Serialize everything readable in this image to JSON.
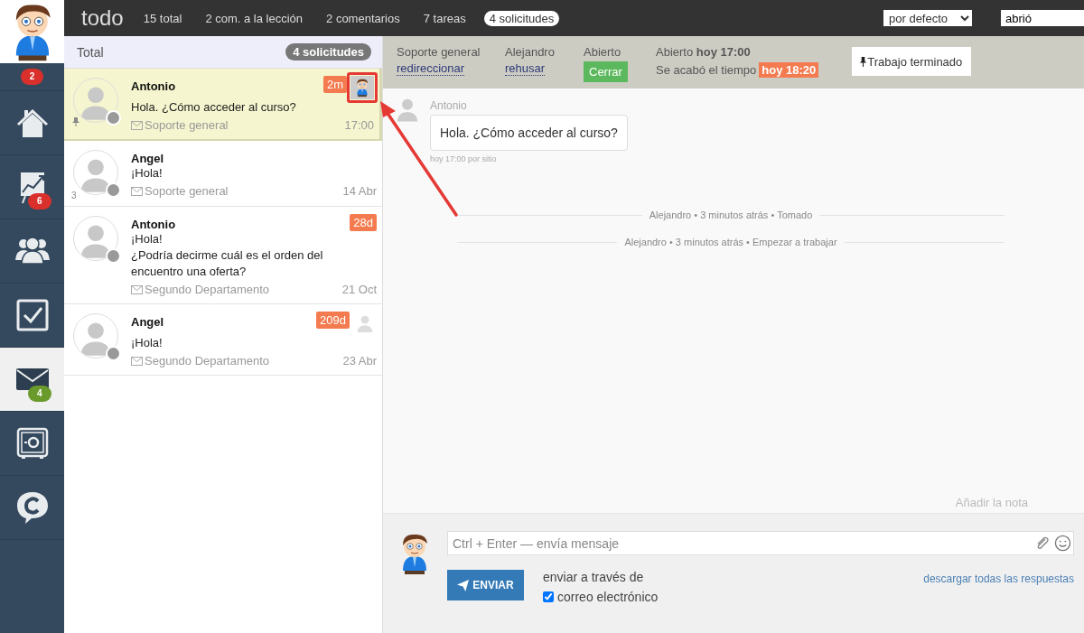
{
  "sidebar": {
    "alert_badge": {
      "text": "2",
      "color": "#d9302c"
    },
    "items": [
      {
        "kind": "home",
        "selected": false
      },
      {
        "kind": "chart",
        "selected": false,
        "badge": "6",
        "color": "#d9302c"
      },
      {
        "kind": "people",
        "selected": false
      },
      {
        "kind": "checkbox",
        "selected": false
      },
      {
        "kind": "mail",
        "selected": true,
        "badge": "4",
        "color": "#6b9a2c"
      },
      {
        "kind": "safe",
        "selected": false
      },
      {
        "kind": "chat",
        "selected": false
      }
    ]
  },
  "topbar": {
    "title": "todo",
    "tabs": [
      {
        "label": "15 total",
        "selected": false
      },
      {
        "label": "2 com. a la lección",
        "selected": false
      },
      {
        "label": "2 comentarios",
        "selected": false
      },
      {
        "label": "7 tareas",
        "selected": false
      },
      {
        "label": "4 solicitudes",
        "selected": true
      }
    ],
    "sort": "por defecto",
    "filter": "abrió"
  },
  "list": {
    "title": "Total",
    "count": "4 solicitudes",
    "tickets": [
      {
        "name": "Antonio",
        "lines": [
          "Hola. ¿Cómo acceder al curso?"
        ],
        "department": "Soporte general",
        "time": "17:00",
        "age": "2m",
        "assignee": {
          "kind": "avatar",
          "highlighted": true
        },
        "pinned": true,
        "selected": true
      },
      {
        "name": "Angel",
        "lines": [
          "¡Hola!"
        ],
        "department": "Soporte general",
        "time": "14 Abr",
        "count": "3",
        "pinned": false,
        "selected": false
      },
      {
        "name": "Antonio",
        "lines": [
          "¡Hola!",
          "¿Podría decirme cuál es el orden del encuentro una oferta?"
        ],
        "department": "Segundo Departamento",
        "time": "21 Oct",
        "age": "28d",
        "pinned": false,
        "selected": false
      },
      {
        "name": "Angel",
        "lines": [
          "¡Hola!"
        ],
        "department": "Segundo Departamento",
        "time": "23 Abr",
        "age": "209d",
        "assignee": {
          "kind": "placeholder",
          "highlighted": false
        },
        "pinned": false,
        "selected": false
      }
    ]
  },
  "header": {
    "department": {
      "label": "Soporte general",
      "action": "redireccionar"
    },
    "assignee": {
      "label": "Alejandro",
      "action": "rehusar"
    },
    "status": {
      "label": "Abierto",
      "action": "Cerrar"
    },
    "opened": "Abierto **hoy 17:00**",
    "deadline": {
      "label": "Se acabó el tiempo",
      "value": "hoy 18:20"
    },
    "done_button": "Trabajo terminado"
  },
  "chat": {
    "message": {
      "author": "Antonio",
      "text": "Hola. ¿Cómo acceder al curso?",
      "meta": "hoy 17:00 por sitio"
    },
    "events": [
      "Alejandro • 3 minutos atrás • Tomado",
      "Alejandro • 3 minutos atrás • Empezar a trabajar"
    ],
    "add_note": "Añadir la nota"
  },
  "composer": {
    "placeholder": "Ctrl + Enter — envía mensaje",
    "send": "ENVIAR",
    "via": "enviar a través de",
    "email": {
      "label": "correo electrónico",
      "checked": true
    },
    "download": "descargar todas las respuestas"
  }
}
